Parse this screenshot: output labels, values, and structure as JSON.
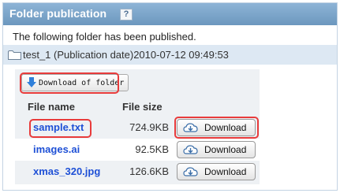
{
  "header": {
    "title": "Folder publication",
    "help": "?"
  },
  "message": "The following folder has been published.",
  "folder": {
    "name": "test_1 (Publication date)2010-07-12 09:49:53"
  },
  "download_folder_label": "Download of folder",
  "columns": {
    "name": "File name",
    "size": "File size"
  },
  "files": [
    {
      "name": "sample.txt",
      "size": "724.9KB",
      "button": "Download"
    },
    {
      "name": "images.ai",
      "size": "92.5KB",
      "button": "Download"
    },
    {
      "name": "xmas_320.jpg",
      "size": "126.6KB",
      "button": "Download"
    }
  ],
  "colors": {
    "header": "#7ba4ca",
    "link": "#1e50d6",
    "highlight": "#e83b3b",
    "folder_bar": "#dde8f3"
  }
}
